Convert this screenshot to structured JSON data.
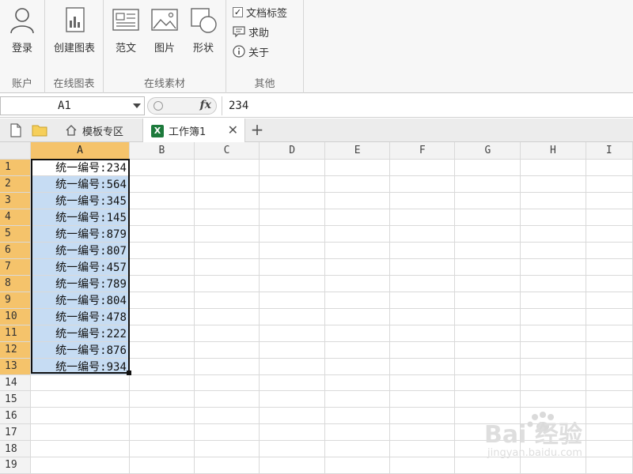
{
  "ribbon": {
    "account": {
      "login_label": "登录",
      "group_label": "账户"
    },
    "chart": {
      "create_chart_label": "创建图表",
      "group_label": "在线图表"
    },
    "materials": {
      "sample_label": "范文",
      "picture_label": "图片",
      "shape_label": "形状",
      "group_label": "在线素材"
    },
    "other": {
      "doc_tab_label": "文档标签",
      "doc_tab_checked": true,
      "help_label": "求助",
      "about_label": "关于",
      "group_label": "其他"
    }
  },
  "formula_bar": {
    "name_box": "A1",
    "fx_label": "fx",
    "value": "234"
  },
  "tabs": {
    "templates_label": "模板专区",
    "workbook_label": "工作簿1",
    "workbook_icon_letter": "X",
    "close_glyph": "✕",
    "add_glyph": "+"
  },
  "sheet": {
    "columns": [
      "A",
      "B",
      "C",
      "D",
      "E",
      "F",
      "G",
      "H",
      "I"
    ],
    "rows": [
      "1",
      "2",
      "3",
      "4",
      "5",
      "6",
      "7",
      "8",
      "9",
      "10",
      "11",
      "12",
      "13",
      "14",
      "15",
      "16",
      "17",
      "18",
      "19"
    ],
    "column_a": [
      "统一编号:234",
      "统一编号:564",
      "统一编号:345",
      "统一编号:145",
      "统一编号:879",
      "统一编号:807",
      "统一编号:457",
      "统一编号:789",
      "统一编号:804",
      "统一编号:478",
      "统一编号:222",
      "统一编号:876",
      "统一编号:934"
    ],
    "selected_range": "A1:A13",
    "colors": {
      "selected_header": "#f5c36b",
      "selected_fill": "#c6dcf3"
    }
  },
  "watermark": {
    "text": "Bai 经验",
    "subtext": "jingyan.baidu.com"
  }
}
